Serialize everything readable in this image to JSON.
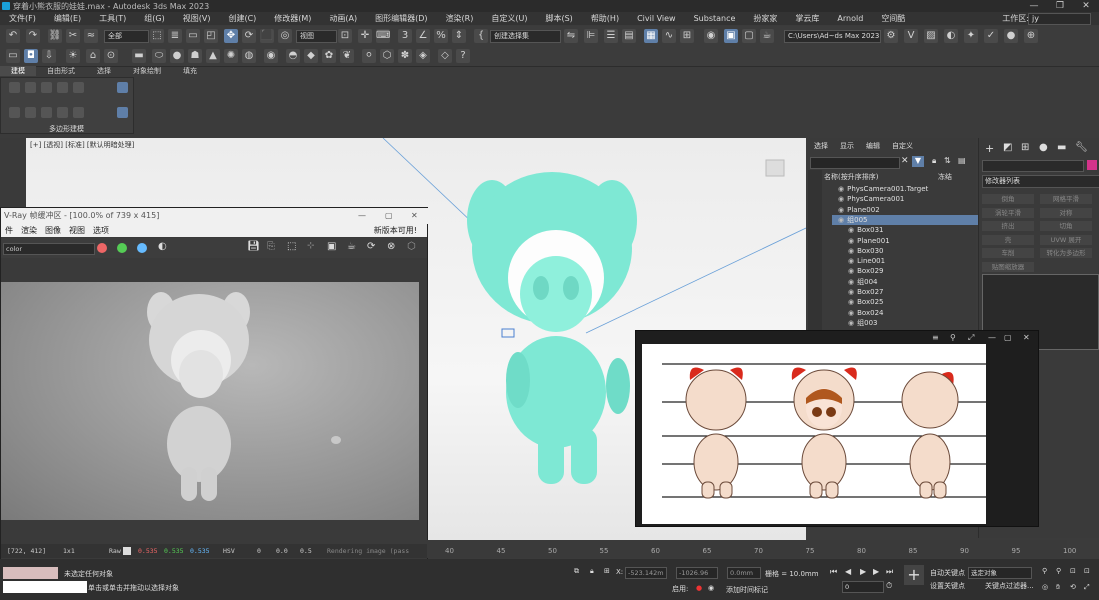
{
  "window": {
    "title": "穿着小熊衣服的娃娃.max - Autodesk 3ds Max 2023",
    "controls": [
      "—",
      "❐",
      "✕"
    ]
  },
  "menu": {
    "items": [
      "文件(F)",
      "编辑(E)",
      "工具(T)",
      "组(G)",
      "视图(V)",
      "创建(C)",
      "修改器(M)",
      "动画(A)",
      "图形编辑器(D)",
      "渲染(R)",
      "自定义(U)",
      "脚本(S)",
      "帮助(H)",
      "Civil View",
      "Substance",
      "扮家家",
      "掌云库",
      "Arnold",
      "空间酷"
    ],
    "workspace_label": "工作区:",
    "workspace_value": "jy"
  },
  "toolbar": {
    "selection_filter": "全部",
    "coord_system": "视图",
    "named_selection": "创建选择集",
    "project_path": "C:\\Users\\Ad~ds Max 2023"
  },
  "ribbon": {
    "tabs": [
      "建模",
      "自由形式",
      "选择",
      "对象绘制",
      "填充"
    ],
    "panel_label": "多边形建模"
  },
  "viewport": {
    "label": "[+] [透视] [标准] [默认明暗处理]"
  },
  "vray": {
    "title": "V-Ray 帧缓冲区 - [100.0% of 739 x 415]",
    "menu": [
      "件",
      "渲染",
      "图像",
      "视图",
      "选项"
    ],
    "update_notice": "新版本可用!",
    "channel": "color",
    "status_coords": "[722, 412]",
    "zoom": "1x1",
    "mode": "Raw",
    "r": "0.535",
    "g": "0.535",
    "b": "0.535",
    "color_space": "HSV",
    "v1": "0",
    "v2": "0.0",
    "v3": "0.5",
    "render_status": "Rendering image (pass"
  },
  "scene_explorer": {
    "tabs": [
      "选择",
      "显示",
      "编辑",
      "自定义"
    ],
    "header_name": "名称(按升序排序)",
    "header_freeze": "冻结",
    "rows": [
      {
        "label": "PhysCamera001.Target",
        "indent": 0,
        "selected": false
      },
      {
        "label": "PhysCamera001",
        "indent": 0,
        "selected": false
      },
      {
        "label": "Plane002",
        "indent": 0,
        "selected": false
      },
      {
        "label": "组005",
        "indent": 0,
        "selected": true
      },
      {
        "label": "Box031",
        "indent": 1,
        "selected": false
      },
      {
        "label": "Plane001",
        "indent": 1,
        "selected": false
      },
      {
        "label": "Box030",
        "indent": 1,
        "selected": false
      },
      {
        "label": "Line001",
        "indent": 1,
        "selected": false
      },
      {
        "label": "Box029",
        "indent": 1,
        "selected": false
      },
      {
        "label": "组004",
        "indent": 1,
        "selected": false
      },
      {
        "label": "Box027",
        "indent": 1,
        "selected": false
      },
      {
        "label": "Box025",
        "indent": 1,
        "selected": false
      },
      {
        "label": "Box024",
        "indent": 1,
        "selected": false
      },
      {
        "label": "组003",
        "indent": 1,
        "selected": false
      }
    ]
  },
  "command_panel": {
    "modifier_list": "修改器列表",
    "buttons": [
      "倒角",
      "网格平滑",
      "涡轮平滑",
      "对称",
      "挤出",
      "切角",
      "壳",
      "UVW 展开",
      "车削",
      "转化为多边形",
      "贴图缩放器"
    ]
  },
  "timeline": {
    "ticks": [
      "40",
      "45",
      "50",
      "55",
      "60",
      "65",
      "70",
      "75",
      "80",
      "85",
      "90",
      "95",
      "100"
    ]
  },
  "status": {
    "selection": "未选定任何对象",
    "prompt": "单击或单击并拖动以选择对象",
    "x_label": "X:",
    "x_value": "-523.142m",
    "y_value": "-1026.96",
    "z_value": "0.0mm",
    "grid": "栅格 = 10.0mm",
    "enable": "启用:",
    "add_time_tag": "添加时间标记",
    "auto_key": "自动关键点",
    "set_key": "设置关键点",
    "selected_object": "选定对象",
    "key_filters": "关键点过滤器...",
    "frame": "0"
  },
  "colors": {
    "accent": "#5f7fa8",
    "character": "#7ee8d4"
  }
}
